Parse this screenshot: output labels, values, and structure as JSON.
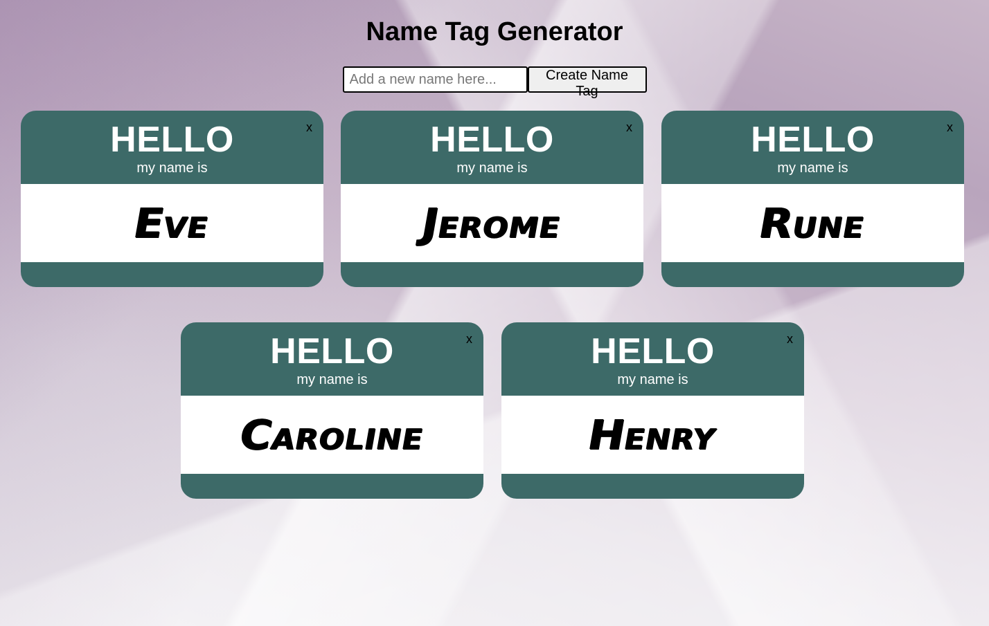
{
  "header": {
    "title": "Name Tag Generator"
  },
  "form": {
    "placeholder": "Add a new name here...",
    "button_label": "Create Name Tag"
  },
  "tag_template": {
    "hello": "HELLO",
    "subtitle": "my name is",
    "close": "x"
  },
  "tags": [
    {
      "name": "Eve"
    },
    {
      "name": "Jerome"
    },
    {
      "name": "Rune"
    },
    {
      "name": "Caroline"
    },
    {
      "name": "Henry"
    }
  ],
  "colors": {
    "tag_band": "#3d6a68",
    "tag_body": "#ffffff"
  },
  "icons": {
    "close": "x-close-icon"
  }
}
